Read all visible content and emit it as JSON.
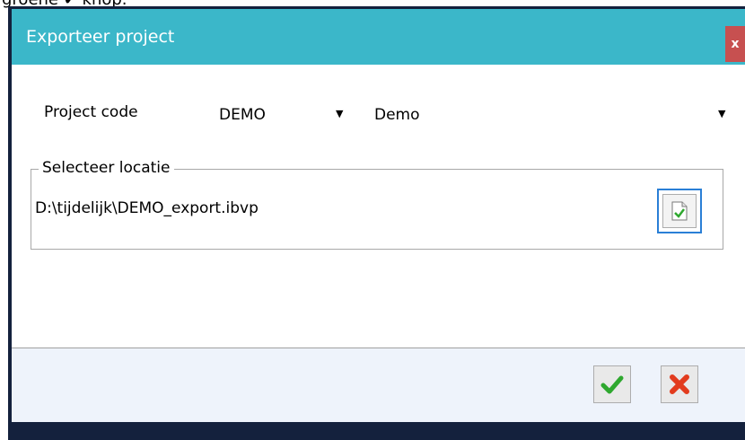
{
  "top_caption": "groene ✔ knop.",
  "dialog": {
    "title": "Exporteer project",
    "close_label": "x"
  },
  "project": {
    "label": "Project code",
    "code_value": "DEMO",
    "name_value": "Demo"
  },
  "location": {
    "group_label": "Selecteer locatie",
    "path": "D:\\tijdelijk\\DEMO_export.ibvp"
  },
  "colors": {
    "titlebar": "#3bb7c9",
    "close": "#c75050",
    "footer": "#eef3fb",
    "confirm": "#2fa82f",
    "cancel": "#e23b1d"
  },
  "icons": {
    "close": "close-icon",
    "dropdown": "caret-down-icon",
    "browse": "file-check-icon",
    "confirm": "checkmark-icon",
    "cancel": "cross-icon"
  }
}
